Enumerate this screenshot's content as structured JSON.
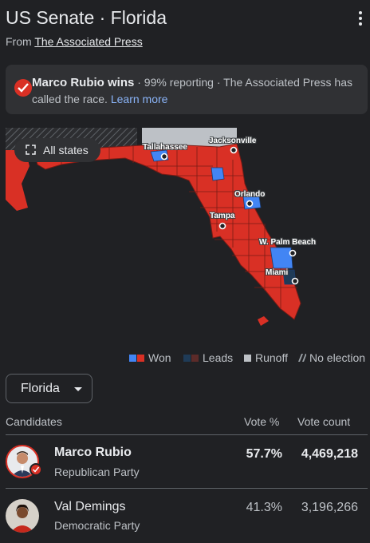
{
  "header": {
    "title": "US Senate · Florida",
    "source_prefix": "From",
    "source_name": "The Associated Press"
  },
  "banner": {
    "winner": "Marco Rubio wins",
    "detail": " · 99% reporting · The Associated Press has called the race. ",
    "link": "Learn more"
  },
  "map": {
    "all_states_label": "All states",
    "cities": [
      "Tallahassee",
      "Jacksonville",
      "Orlando",
      "Tampa",
      "W. Palm Beach",
      "Miami"
    ]
  },
  "legend": {
    "won": "Won",
    "leads": "Leads",
    "runoff": "Runoff",
    "no_election": "No election"
  },
  "state_selector": {
    "value": "Florida"
  },
  "table": {
    "headers": {
      "candidates": "Candidates",
      "vote_pct": "Vote %",
      "vote_count": "Vote count"
    },
    "rows": [
      {
        "name": "Marco Rubio",
        "party": "Republican Party",
        "pct": "57.7%",
        "count": "4,469,218",
        "winner": true
      },
      {
        "name": "Val Demings",
        "party": "Democratic Party",
        "pct": "41.3%",
        "count": "3,196,266",
        "winner": false
      }
    ]
  },
  "colors": {
    "republican": "#d93025",
    "democrat": "#4285f4",
    "republican_lead": "#5c2b29",
    "democrat_lead": "#1f3b57",
    "runoff": "#bdc1c6",
    "background": "#202124",
    "link": "#8ab4f8"
  }
}
